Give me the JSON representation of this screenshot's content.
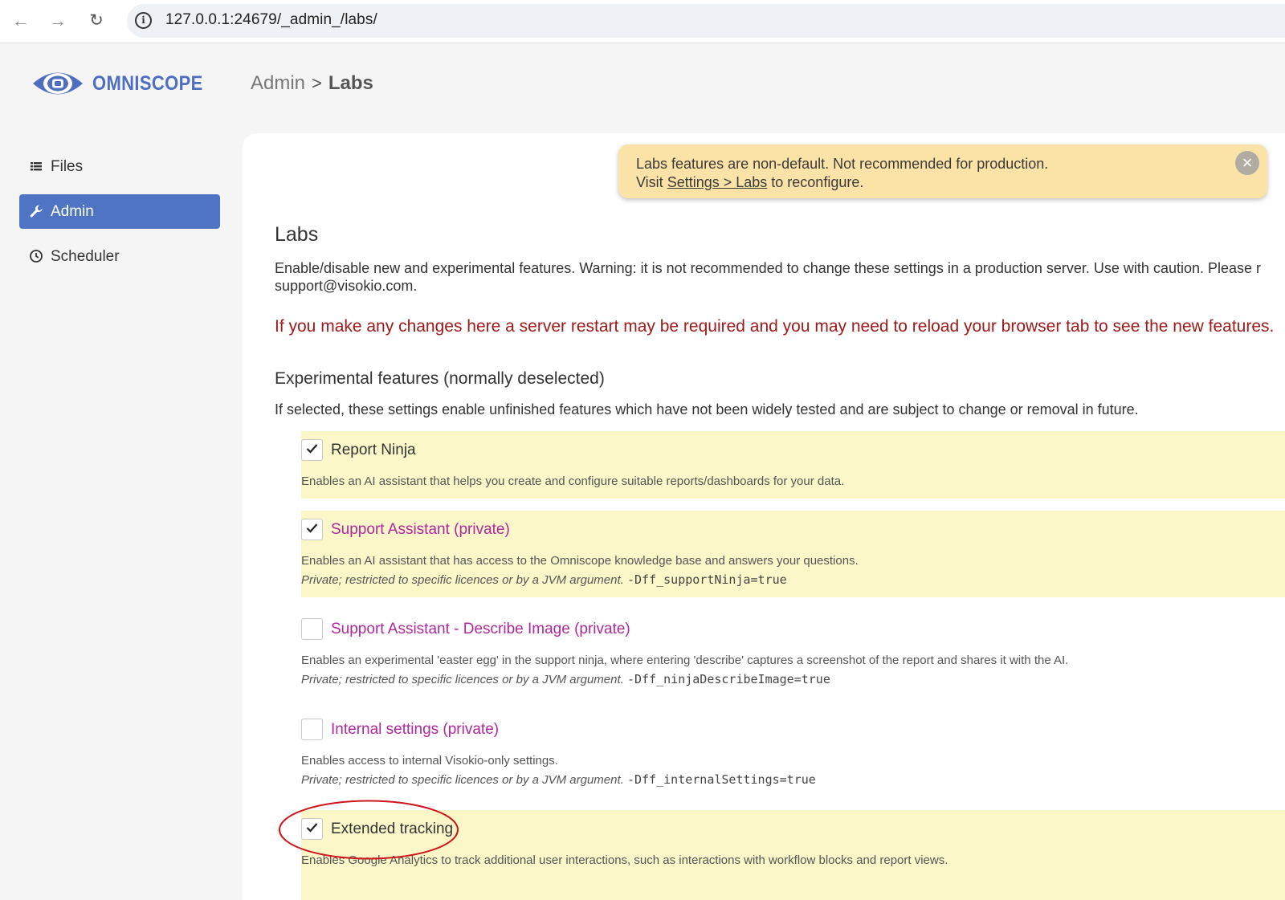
{
  "browser": {
    "url": "127.0.0.1:24679/_admin_/labs/"
  },
  "header": {
    "logo_text": "OMNISCOPE",
    "breadcrumb_parent": "Admin",
    "breadcrumb_separator": ">",
    "breadcrumb_current": "Labs"
  },
  "sidebar": {
    "items": [
      {
        "label": "Files",
        "icon": "list-icon",
        "active": false
      },
      {
        "label": "Admin",
        "icon": "wrench-icon",
        "active": true
      },
      {
        "label": "Scheduler",
        "icon": "clock-icon",
        "active": false
      }
    ]
  },
  "banner": {
    "line1": "Labs features are non-default. Not recommended for production.",
    "line2_prefix": "Visit ",
    "line2_link": "Settings > Labs",
    "line2_suffix": " to reconfigure.",
    "close_glyph": "×"
  },
  "page": {
    "title": "Labs",
    "description": "Enable/disable new and experimental features. Warning: it is not recommended to change these settings in a production server. Use with caution. Please r",
    "description_line2": "support@visokio.com.",
    "warning": "If you make any changes here a server restart may be required and you may need to reload your browser tab to see the new features.",
    "section_title": "Experimental features (normally deselected)",
    "section_description": "If selected, these settings enable unfinished features which have not been widely tested and are subject to change or removal in future."
  },
  "features": [
    {
      "title": "Report Ninja",
      "checked": true,
      "private": false,
      "description": "Enables an AI assistant that helps you create and configure suitable reports/dashboards for your data."
    },
    {
      "title": "Support Assistant (private)",
      "checked": true,
      "private": true,
      "description": "Enables an AI assistant that has access to the Omniscope knowledge base and answers your questions.",
      "note": "Private; restricted to specific licences or by a JVM argument.",
      "arg": "-Dff_supportNinja=true"
    },
    {
      "title": "Support Assistant - Describe Image (private)",
      "checked": false,
      "private": true,
      "description": "Enables an experimental 'easter egg' in the support ninja, where entering 'describe' captures a screenshot of the report and shares it with the AI.",
      "note": "Private; restricted to specific licences or by a JVM argument.",
      "arg": "-Dff_ninjaDescribeImage=true"
    },
    {
      "title": "Internal settings (private)",
      "checked": false,
      "private": true,
      "description": "Enables access to internal Visokio-only settings.",
      "note": "Private; restricted to specific licences or by a JVM argument.",
      "arg": "-Dff_internalSettings=true"
    },
    {
      "title": "Extended tracking",
      "checked": true,
      "private": false,
      "description": "Enables Google Analytics to track additional user interactions, such as interactions with workflow blocks and report views."
    }
  ],
  "colors": {
    "brand": "#4e6fc0",
    "sidebar_active": "#4f74c4",
    "banner_bg": "#fbe3a8",
    "feature_on_bg": "#fbf7c8",
    "private_title": "#b0289c",
    "warning_text": "#a01a1a",
    "annotation": "#d0141c"
  }
}
